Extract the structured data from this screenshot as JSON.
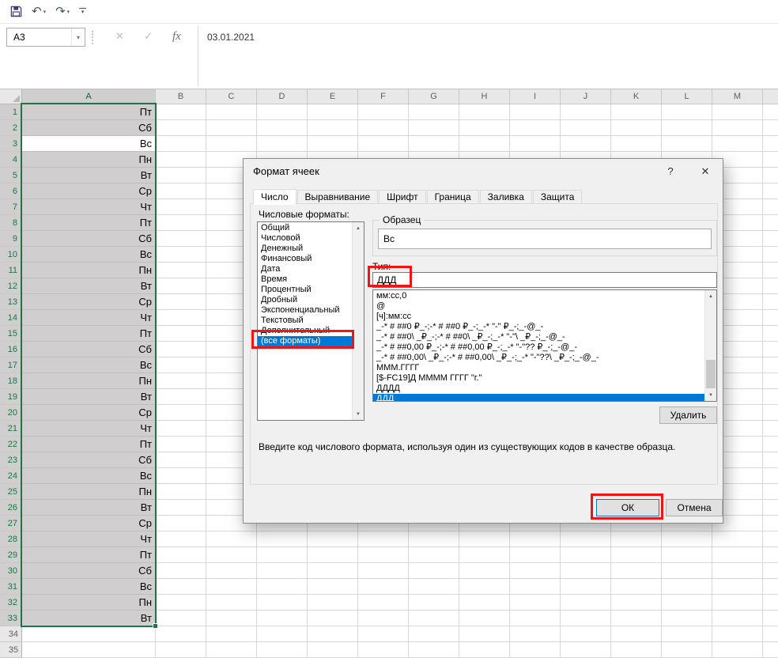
{
  "colors": {
    "accent_green": "#217346",
    "selection_fill": "#D0CECE",
    "header_bg": "#E8E8E8",
    "list_selection": "#0078D7",
    "annotation_red": "#F01414"
  },
  "icons": {
    "dropdown": "▾",
    "undo": "↶",
    "redo": "↷",
    "cancel": "✕",
    "enter": "✓",
    "fx": "fx",
    "help": "?",
    "close": "✕",
    "scroll_up": "▲",
    "scroll_down": "▼"
  },
  "formula_bar": {
    "name_box_value": "A3",
    "formula_value": "03.01.2021"
  },
  "sheet": {
    "column_headers": [
      "A",
      "B",
      "C",
      "D",
      "E",
      "F",
      "G",
      "H",
      "I",
      "J",
      "K",
      "L",
      "M"
    ],
    "row_count": 35,
    "selection_range": "A1:A33",
    "active_cell": "A3",
    "column_a_values": [
      "Пт",
      "Сб",
      "Вс",
      "Пн",
      "Вт",
      "Ср",
      "Чт",
      "Пт",
      "Сб",
      "Вс",
      "Пн",
      "Вт",
      "Ср",
      "Чт",
      "Пт",
      "Сб",
      "Вс",
      "Пн",
      "Вт",
      "Ср",
      "Чт",
      "Пт",
      "Сб",
      "Вс",
      "Пн",
      "Вт",
      "Ср",
      "Чт",
      "Пт",
      "Сб",
      "Вс",
      "Пн",
      "Вт"
    ]
  },
  "dialog": {
    "title": "Формат ячеек",
    "tabs": [
      "Число",
      "Выравнивание",
      "Шрифт",
      "Граница",
      "Заливка",
      "Защита"
    ],
    "active_tab": "Число",
    "categories_label": "Числовые форматы:",
    "categories": [
      "Общий",
      "Числовой",
      "Денежный",
      "Финансовый",
      "Дата",
      "Время",
      "Процентный",
      "Дробный",
      "Экспоненциальный",
      "Текстовый",
      "Дополнительный",
      "(все форматы)"
    ],
    "selected_category": "(все форматы)",
    "sample_label": "Образец",
    "sample_value": "Вс",
    "type_label": "Тип:",
    "type_value": "ДДД",
    "format_codes": [
      "мм:сс,0",
      "@",
      "[ч]:мм:сс",
      "_-* # ##0 ₽_-;-* # ##0 ₽_-;_-* \"-\" ₽_-;_-@_-",
      "_-* # ##0\\ _₽_-;-* # ##0\\ _₽_-;_-* \"-\"\\ _₽_-;_-@_-",
      "_-* # ##0,00 ₽_-;-* # ##0,00 ₽_-;_-* \"-\"?? ₽_-;_-@_-",
      "_-* # ##0,00\\ _₽_-;-* # ##0,00\\ _₽_-;_-* \"-\"??\\ _₽_-;_-@_-",
      "МММ.ГГГГ",
      "[$-FC19]Д ММММ ГГГГ \"г.\"",
      "ДДДД",
      "ДДД"
    ],
    "selected_code": "ДДД",
    "delete_button": "Удалить",
    "description": "Введите код числового формата, используя один из существующих кодов в качестве образца.",
    "ok_button": "ОК",
    "cancel_button": "Отмена"
  }
}
